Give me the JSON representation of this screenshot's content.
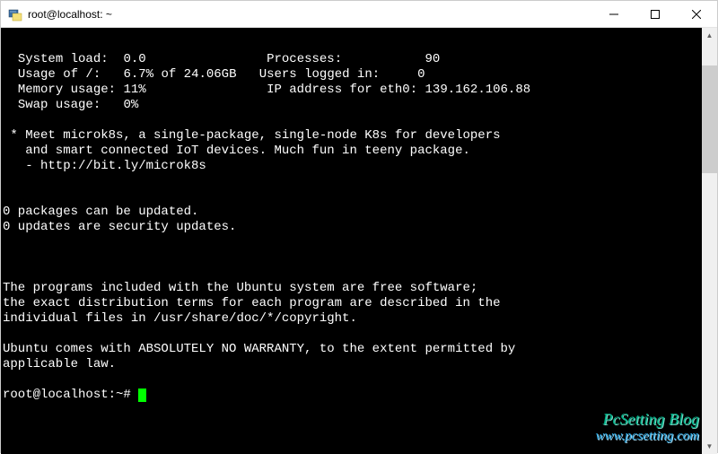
{
  "window": {
    "title": "root@localhost: ~"
  },
  "stats": {
    "system_load_label": "System load:",
    "system_load_value": "0.0",
    "processes_label": "Processes:",
    "processes_value": "90",
    "usage_of_label": "Usage of /:",
    "usage_of_value": "6.7% of 24.06GB",
    "users_logged_label": "Users logged in:",
    "users_logged_value": "0",
    "memory_usage_label": "Memory usage:",
    "memory_usage_value": "11%",
    "ip_label": "IP address for eth0:",
    "ip_value": "139.162.106.88",
    "swap_usage_label": "Swap usage:",
    "swap_usage_value": "0%"
  },
  "motd": {
    "line1": " * Meet microk8s, a single-package, single-node K8s for developers",
    "line2": "   and smart connected IoT devices. Much fun in teeny package.",
    "line3": "   - http://bit.ly/microk8s"
  },
  "updates": {
    "line1": "0 packages can be updated.",
    "line2": "0 updates are security updates."
  },
  "legal": {
    "line1": "The programs included with the Ubuntu system are free software;",
    "line2": "the exact distribution terms for each program are described in the",
    "line3": "individual files in /usr/share/doc/*/copyright.",
    "line4": "Ubuntu comes with ABSOLUTELY NO WARRANTY, to the extent permitted by",
    "line5": "applicable law."
  },
  "prompt": {
    "text": "root@localhost:~# "
  },
  "watermark": {
    "line1": "PcSetting Blog",
    "line2": "www.pcsetting.com"
  }
}
